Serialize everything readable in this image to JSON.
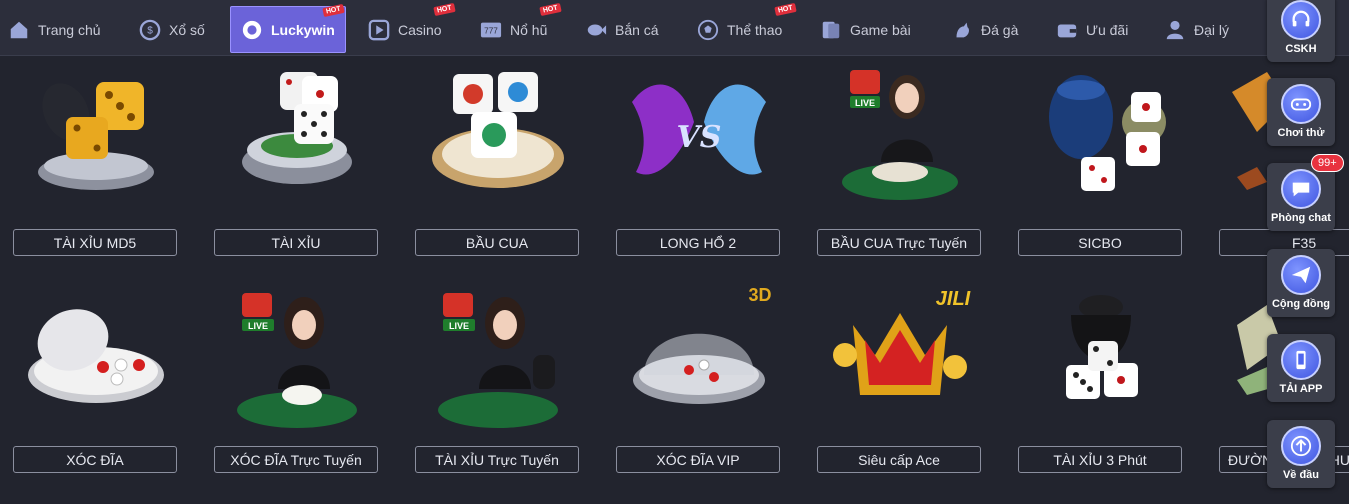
{
  "nav": {
    "items": [
      {
        "label": "Trang chủ",
        "icon": "home-icon",
        "hot": false,
        "active": false
      },
      {
        "label": "Xổ số",
        "icon": "lottery-coin-icon",
        "hot": false,
        "active": false
      },
      {
        "label": "Luckywin",
        "icon": "luckywin-chip-icon",
        "hot": true,
        "active": true
      },
      {
        "label": "Casino",
        "icon": "casino-play-icon",
        "hot": true,
        "active": false
      },
      {
        "label": "Nổ hũ",
        "icon": "slot-machine-icon",
        "hot": true,
        "active": false
      },
      {
        "label": "Bắn cá",
        "icon": "fish-icon",
        "hot": false,
        "active": false
      },
      {
        "label": "Thể thao",
        "icon": "soccer-ball-icon",
        "hot": true,
        "active": false
      },
      {
        "label": "Game bài",
        "icon": "playing-cards-icon",
        "hot": false,
        "active": false
      },
      {
        "label": "Đá gà",
        "icon": "rooster-icon",
        "hot": false,
        "active": false
      },
      {
        "label": "Ưu đãi",
        "icon": "gift-wallet-icon",
        "hot": false,
        "active": false
      },
      {
        "label": "Đại lý",
        "icon": "agent-person-icon",
        "hot": false,
        "active": false
      }
    ],
    "hot_label": "HOT"
  },
  "games": [
    {
      "label": "TÀI XỈU MD5",
      "art": "gold-dice-cup"
    },
    {
      "label": "TÀI XỈU",
      "art": "white-dice-bowl"
    },
    {
      "label": "BẦU CUA",
      "art": "animal-dice-plate"
    },
    {
      "label": "LONG HỔ 2",
      "art": "dragon-vs-tiger"
    },
    {
      "label": "BẦU CUA Trực Tuyến",
      "art": "live-dealer-baucua"
    },
    {
      "label": "SICBO",
      "art": "sicbo-cup-dice"
    },
    {
      "label": "F35",
      "art": "f35-jet"
    },
    {
      "label": "XÓC ĐĨA",
      "art": "white-bowl-plate"
    },
    {
      "label": "XÓC ĐĨA Trực Tuyến",
      "art": "live-dealer-xocdia"
    },
    {
      "label": "TÀI XỈU Trực Tuyến",
      "art": "live-dealer-taixiu"
    },
    {
      "label": "XÓC ĐĨA VIP",
      "art": "glass-dome-3d"
    },
    {
      "label": "Siêu cấp Ace",
      "art": "jili-crown"
    },
    {
      "label": "TÀI XỈU 3 Phút",
      "art": "black-cup-dice"
    },
    {
      "label": "ĐƯỜNG ĐUA CHU",
      "art": "partial-game"
    }
  ],
  "badges": {
    "live": "LIVE",
    "three_d": "3D",
    "jili": "JILI"
  },
  "side_buttons": [
    {
      "label": "CSKH",
      "icon": "support-headset-icon"
    },
    {
      "label": "Chơi thử",
      "icon": "gamepad-icon"
    },
    {
      "label": "Phòng chat",
      "icon": "chat-bubble-icon"
    },
    {
      "label": "Cộng đồng",
      "icon": "send-plane-icon"
    },
    {
      "label": "TẢI APP",
      "icon": "mobile-phone-icon"
    },
    {
      "label": "Về đầu",
      "icon": "arrow-up-icon"
    }
  ],
  "chat_badge": "99+",
  "colors": {
    "active_nav": "#6b63d9",
    "hot": "#e02f3c",
    "side_accent": "#4f66ee",
    "bg": "#22242e"
  }
}
